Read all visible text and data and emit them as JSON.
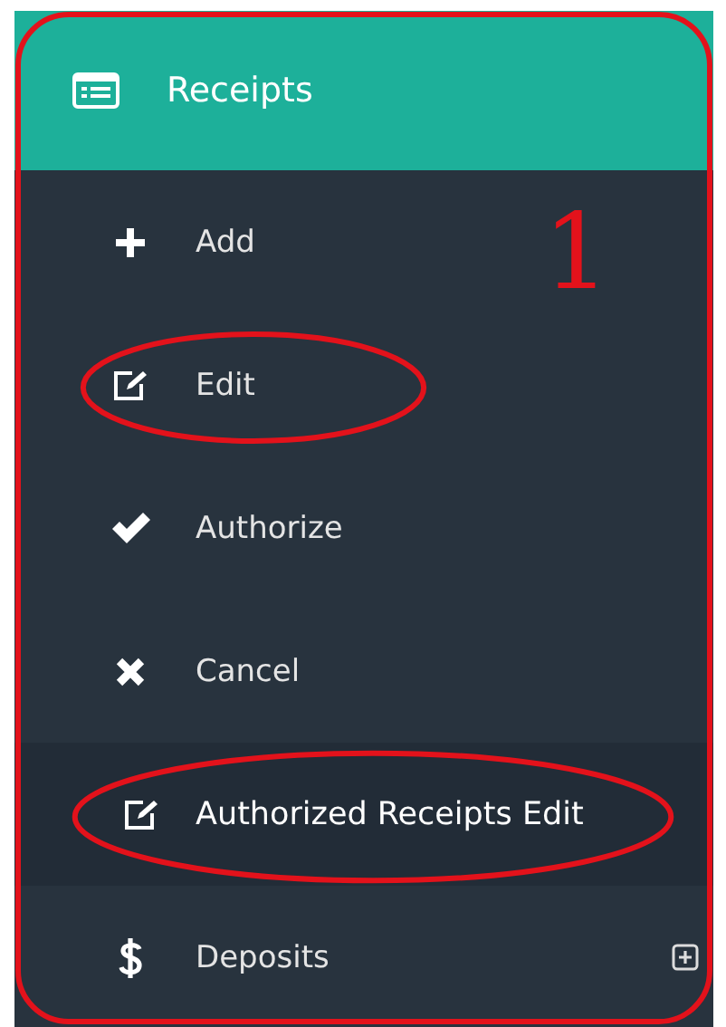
{
  "menu": {
    "title": "Receipts",
    "items": [
      {
        "label": "Add",
        "kind": "plus",
        "selected": false
      },
      {
        "label": "Edit",
        "kind": "edit",
        "selected": false,
        "circled": true
      },
      {
        "label": "Authorize",
        "kind": "check",
        "selected": false
      },
      {
        "label": "Cancel",
        "kind": "cross",
        "selected": false
      },
      {
        "label": "Authorized Receipts Edit",
        "kind": "edit",
        "selected": true,
        "circled": true
      },
      {
        "label": "Deposits",
        "kind": "dollar",
        "selected": false,
        "expandable": true
      }
    ]
  },
  "annotation": {
    "number": "1"
  }
}
